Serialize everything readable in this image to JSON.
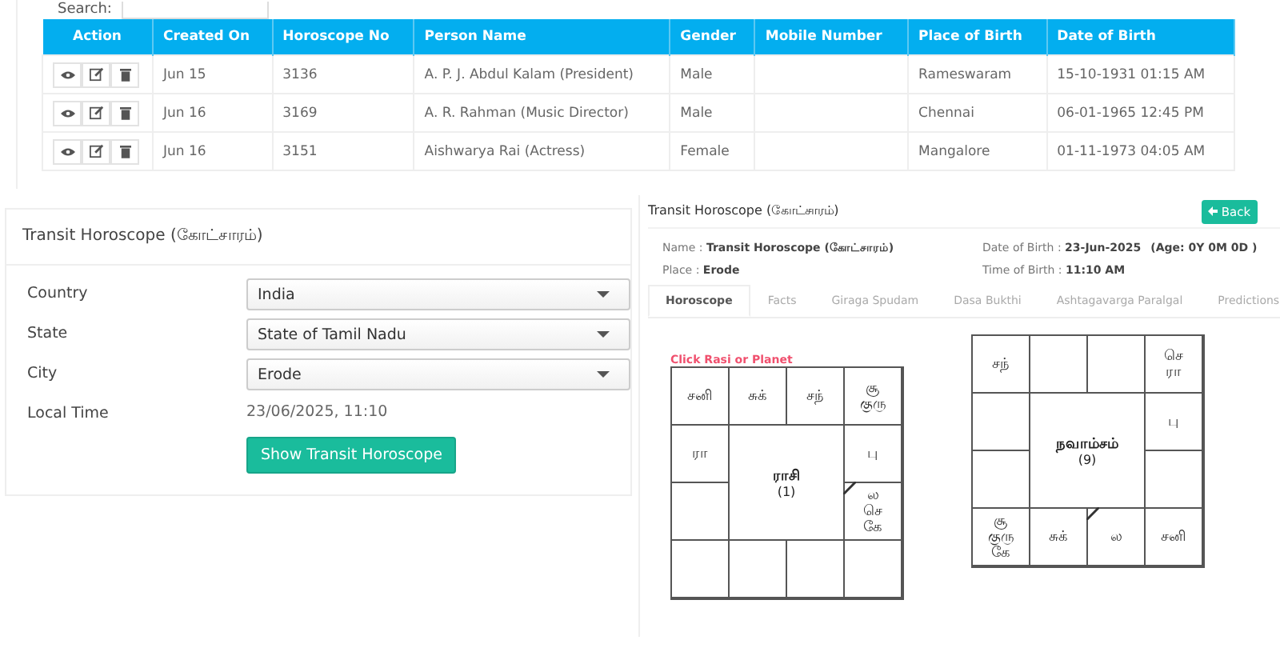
{
  "search": {
    "label": "Search:"
  },
  "table": {
    "columns": [
      "Action",
      "Created On",
      "Horoscope No",
      "Person Name",
      "Gender",
      "Mobile Number",
      "Place of Birth",
      "Date of Birth"
    ],
    "rows": [
      {
        "created_on": "Jun 15",
        "horoscope_no": "3136",
        "person_name": "A. P. J. Abdul Kalam (President)",
        "gender": "Male",
        "place_of_birth": "Rameswaram",
        "date_of_birth": "15-10-1931 01:15 AM"
      },
      {
        "created_on": "Jun 16",
        "horoscope_no": "3169",
        "person_name": "A. R. Rahman (Music Director)",
        "gender": "Male",
        "place_of_birth": "Chennai",
        "date_of_birth": "06-01-1965 12:45 PM"
      },
      {
        "created_on": "Jun 16",
        "horoscope_no": "3151",
        "person_name": "Aishwarya Rai (Actress)",
        "gender": "Female",
        "place_of_birth": "Mangalore",
        "date_of_birth": "01-11-1973 04:05 AM"
      }
    ]
  },
  "form_panel": {
    "title": "Transit Horoscope (கோட்சாரம்)",
    "fields": [
      {
        "kind": "select",
        "label": "Country",
        "value": "India"
      },
      {
        "kind": "select",
        "label": "State",
        "value": "State of Tamil Nadu"
      },
      {
        "kind": "select",
        "label": "City",
        "value": "Erode"
      },
      {
        "kind": "text",
        "label": "Local Time",
        "value": "23/06/2025, 11:10"
      }
    ],
    "button": "Show Transit Horoscope"
  },
  "result_panel": {
    "title": "Transit Horoscope (கோட்சாரம்)",
    "back_button": "Back",
    "info": [
      {
        "label": "Name : ",
        "value": "Transit Horoscope (கோட்சாரம்)"
      },
      {
        "label": "Date of Birth : ",
        "value": "23-Jun-2025",
        "extra": "(Age: 0Y 0M 0D )"
      },
      {
        "label": "Place : ",
        "value": "Erode"
      },
      {
        "label": "Time of Birth : ",
        "value": "11:10 AM"
      }
    ],
    "tabs": [
      {
        "label": "Horoscope",
        "selected": true
      },
      {
        "label": "Facts",
        "selected": false
      },
      {
        "label": "Giraga Spudam",
        "selected": false
      },
      {
        "label": "Dasa Bukthi",
        "selected": false
      },
      {
        "label": "Ashtagavarga Paralgal",
        "selected": false
      },
      {
        "label": "Predictions",
        "selected": false
      }
    ],
    "hint": "Click Rasi or Planet",
    "charts": [
      {
        "center": "ராசி",
        "number": "(1)",
        "cells": [
          {
            "planets": [
              "சனி"
            ],
            "lagna": false
          },
          {
            "planets": [
              "சுக்"
            ],
            "lagna": false
          },
          {
            "planets": [
              "சந்"
            ],
            "lagna": false
          },
          {
            "planets": [
              "சூ",
              "குரு"
            ],
            "lagna": false
          },
          {
            "planets": [
              "ரா"
            ],
            "lagna": false
          },
          {
            "planets": [
              "பு"
            ],
            "lagna": false
          },
          {
            "lagna": false
          },
          {
            "planets": [
              "ல",
              "செ",
              "கே"
            ],
            "lagna": true
          },
          {
            "lagna": false
          },
          {
            "lagna": false
          },
          {
            "lagna": false
          },
          {
            "lagna": false
          }
        ]
      },
      {
        "center": "நவாம்சம்",
        "number": "(9)",
        "cells": [
          {
            "planets": [
              "சந்"
            ],
            "lagna": false
          },
          {
            "lagna": false
          },
          {
            "lagna": false
          },
          {
            "planets": [
              "செ",
              "ரா"
            ],
            "lagna": false
          },
          {
            "lagna": false
          },
          {
            "planets": [
              "பு"
            ],
            "lagna": false
          },
          {
            "lagna": false
          },
          {
            "lagna": false
          },
          {
            "planets": [
              "சூ",
              "குரு",
              "கே"
            ],
            "lagna": false
          },
          {
            "planets": [
              "சுக்"
            ],
            "lagna": false
          },
          {
            "planets": [
              "ல"
            ],
            "lagna": true
          },
          {
            "planets": [
              "சனி"
            ],
            "lagna": false
          }
        ]
      }
    ]
  }
}
